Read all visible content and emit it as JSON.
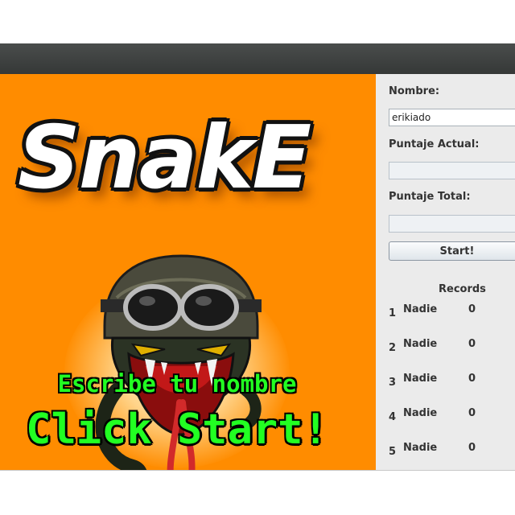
{
  "game": {
    "logo_text": "SnakE",
    "line1": "Escribe tu nombre",
    "line2": "Click Start!"
  },
  "panel": {
    "name_label": "Nombre:",
    "name_value": "erikiado",
    "current_score_label": "Puntaje Actual:",
    "current_score_value": "",
    "total_score_label": "Puntaje Total:",
    "total_score_value": "",
    "start_label": "Start!",
    "records_title": "Records",
    "records": [
      {
        "rank": "1",
        "name": "Nadie",
        "score": "0"
      },
      {
        "rank": "2",
        "name": "Nadie",
        "score": "0"
      },
      {
        "rank": "3",
        "name": "Nadie",
        "score": "0"
      },
      {
        "rank": "4",
        "name": "Nadie",
        "score": "0"
      },
      {
        "rank": "5",
        "name": "Nadie",
        "score": "0"
      }
    ]
  },
  "colors": {
    "game_background": "#ff8c00",
    "overlay_text": "#22ff22",
    "titlebar": "#3c3f3e",
    "panel_background": "#ebebeb"
  }
}
